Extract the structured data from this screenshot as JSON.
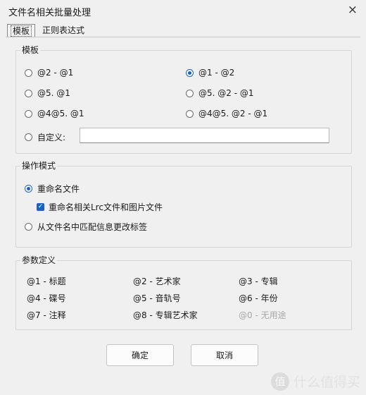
{
  "window": {
    "title": "文件名相关批量处理",
    "close_icon": "×"
  },
  "tabs": [
    {
      "label": "模板",
      "active": true
    },
    {
      "label": "正则表达式",
      "active": false
    }
  ],
  "template_group": {
    "title": "模板",
    "options": [
      {
        "label": "@2 - @1",
        "checked": false
      },
      {
        "label": "@1 - @2",
        "checked": true
      },
      {
        "label": "@5. @1",
        "checked": false
      },
      {
        "label": "@5. @2 - @1",
        "checked": false
      },
      {
        "label": "@4@5. @1",
        "checked": false
      },
      {
        "label": "@4@5. @2 - @1",
        "checked": false
      }
    ],
    "custom": {
      "label": "自定义:",
      "checked": false,
      "value": ""
    }
  },
  "mode_group": {
    "title": "操作模式",
    "rename": {
      "label": "重命名文件",
      "checked": true
    },
    "rename_related": {
      "label": "重命名相关Lrc文件和图片文件",
      "checked": true
    },
    "match_tags": {
      "label": "从文件名中匹配信息更改标签",
      "checked": false
    }
  },
  "params_group": {
    "title": "参数定义",
    "items": [
      {
        "text": "@1 - 标题",
        "disabled": false
      },
      {
        "text": "@2 - 艺术家",
        "disabled": false
      },
      {
        "text": "@3 - 专辑",
        "disabled": false
      },
      {
        "text": "@4 - 碟号",
        "disabled": false
      },
      {
        "text": "@5 - 音轨号",
        "disabled": false
      },
      {
        "text": "@6 - 年份",
        "disabled": false
      },
      {
        "text": "@7 - 注释",
        "disabled": false
      },
      {
        "text": "@8 - 专辑艺术家",
        "disabled": false
      },
      {
        "text": "@0 - 无用途",
        "disabled": true
      }
    ]
  },
  "buttons": {
    "ok": "确定",
    "cancel": "取消"
  },
  "watermark": {
    "icon": "值",
    "text": "什么值得买"
  }
}
